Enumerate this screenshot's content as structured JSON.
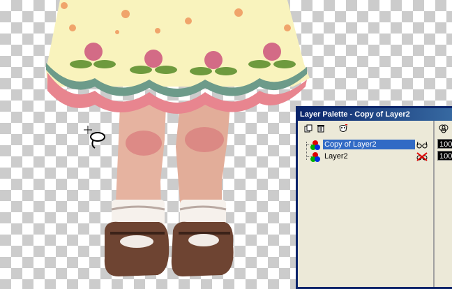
{
  "palette": {
    "title": "Layer Palette - Copy of Layer2",
    "toolbar": {
      "new_icon": "new-layer-icon",
      "delete_icon": "trash-icon",
      "mask_icon": "mask-icon"
    },
    "layers": [
      {
        "name": "Copy of Layer2",
        "selected": true,
        "visibility": "visible-glasses-icon"
      },
      {
        "name": "Layer2",
        "selected": false,
        "visibility": "hidden-glasses-icon"
      }
    ],
    "opacity": [
      "100",
      "100"
    ]
  },
  "colors": {
    "title_bar": "#0a246a",
    "selection": "#316ac5",
    "panel": "#ece9d8"
  }
}
